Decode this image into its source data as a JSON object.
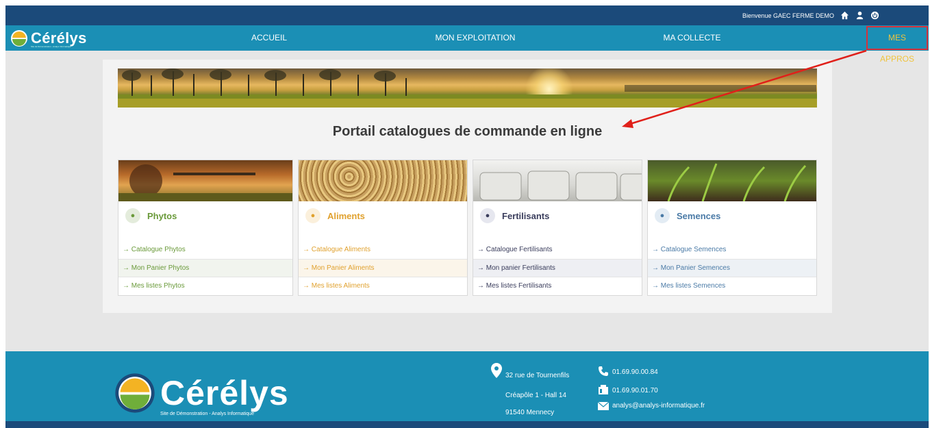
{
  "topbar": {
    "welcome": "Bienvenue GAEC FERME DEMO",
    "icons": [
      "home-icon",
      "user-icon",
      "power-icon"
    ]
  },
  "nav": {
    "logo": "Cérélys",
    "logo_sub": "Site de Démonstration - Analys Informatique",
    "items": [
      "ACCUEIL",
      "MON EXPLOITATION",
      "MA COLLECTE",
      "MES APPROS"
    ],
    "active": "MES APPROS"
  },
  "main": {
    "title": "Portail catalogues de commande en ligne"
  },
  "cards": [
    {
      "title": "Phytos",
      "color": "#6a9a3a",
      "hover": "#f1f4ee",
      "links": [
        "Catalogue Phytos",
        "Mon Panier Phytos",
        "Mes listes Phytos"
      ]
    },
    {
      "title": "Aliments",
      "color": "#e0a12e",
      "hover": "#fbf5ea",
      "links": [
        "Catalogue Aliments",
        "Mon Panier Aliments",
        "Mes listes Aliments"
      ]
    },
    {
      "title": "Fertilisants",
      "color": "#3a3d5c",
      "hover": "#eeeff3",
      "links": [
        "Catalogue Fertilisants",
        "Mon panier Fertilisants",
        "Mes listes Fertilisants"
      ]
    },
    {
      "title": "Semences",
      "color": "#4a7aa6",
      "hover": "#edf1f5",
      "links": [
        "Catalogue Semences",
        "Mon Panier Semences",
        "Mes listes Semences"
      ]
    }
  ],
  "footer": {
    "logo": "Cérélys",
    "logo_sub": "Site de Démonstration - Analys Informatique",
    "address": [
      "32 rue de Tournenfils",
      "Créapôle 1 - Hall 14",
      "91540 Mennecy"
    ],
    "phone": "01.69.90.00.84",
    "fax": "01.69.90.01.70",
    "email": "analys@analys-informatique.fr"
  }
}
